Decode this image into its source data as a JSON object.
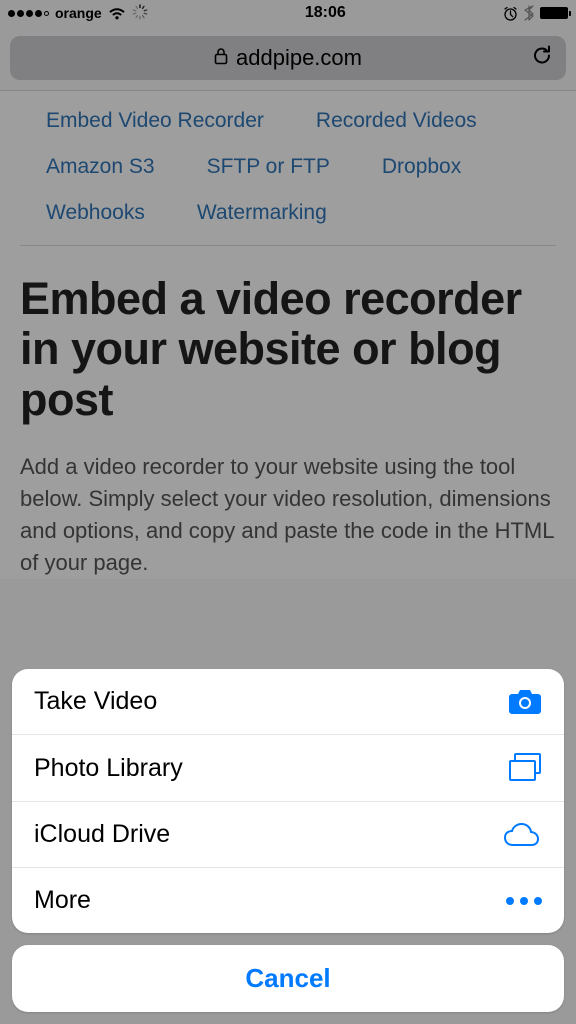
{
  "status": {
    "carrier": "orange",
    "time": "18:06"
  },
  "url": {
    "domain": "addpipe.com"
  },
  "nav": {
    "items": [
      "Embed Video Recorder",
      "Recorded Videos",
      "Amazon S3",
      "SFTP or FTP",
      "Dropbox",
      "Webhooks",
      "Watermarking"
    ]
  },
  "article": {
    "heading": "Embed a video recorder in your website or blog post",
    "body": "Add a video recorder to your website using the tool below. Simply select your video resolution, dimensions and options, and copy and paste the code in the HTML of your page."
  },
  "sheet": {
    "items": [
      {
        "label": "Take Video"
      },
      {
        "label": "Photo Library"
      },
      {
        "label": "iCloud Drive"
      },
      {
        "label": "More"
      }
    ],
    "cancel": "Cancel"
  }
}
